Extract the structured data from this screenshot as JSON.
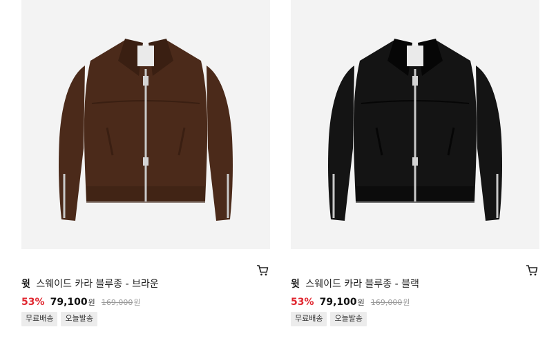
{
  "products": [
    {
      "image_alt": "Brown suede collar zip jacket",
      "jacket_color": "#4b2a1a",
      "jacket_shade": "#3a1f12",
      "brand": "윗",
      "name": "스웨이드 카라 블루종 - 브라운",
      "discount_rate": "53%",
      "sale_price": "79,100",
      "sale_unit": "원",
      "original_price": "169,000",
      "original_unit": "원",
      "tags": [
        "무료배송",
        "오늘발송"
      ],
      "cart_icon": "cart-icon"
    },
    {
      "image_alt": "Black suede collar zip jacket",
      "jacket_color": "#141414",
      "jacket_shade": "#060606",
      "brand": "윗",
      "name": "스웨이드 카라 블루종 - 블랙",
      "discount_rate": "53%",
      "sale_price": "79,100",
      "sale_unit": "원",
      "original_price": "169,000",
      "original_unit": "원",
      "tags": [
        "무료배송",
        "오늘발송"
      ],
      "cart_icon": "cart-icon"
    }
  ],
  "colors": {
    "discount": "#e0262f",
    "tag_bg": "#ececec",
    "thumb_bg": "#f3f3f3"
  }
}
